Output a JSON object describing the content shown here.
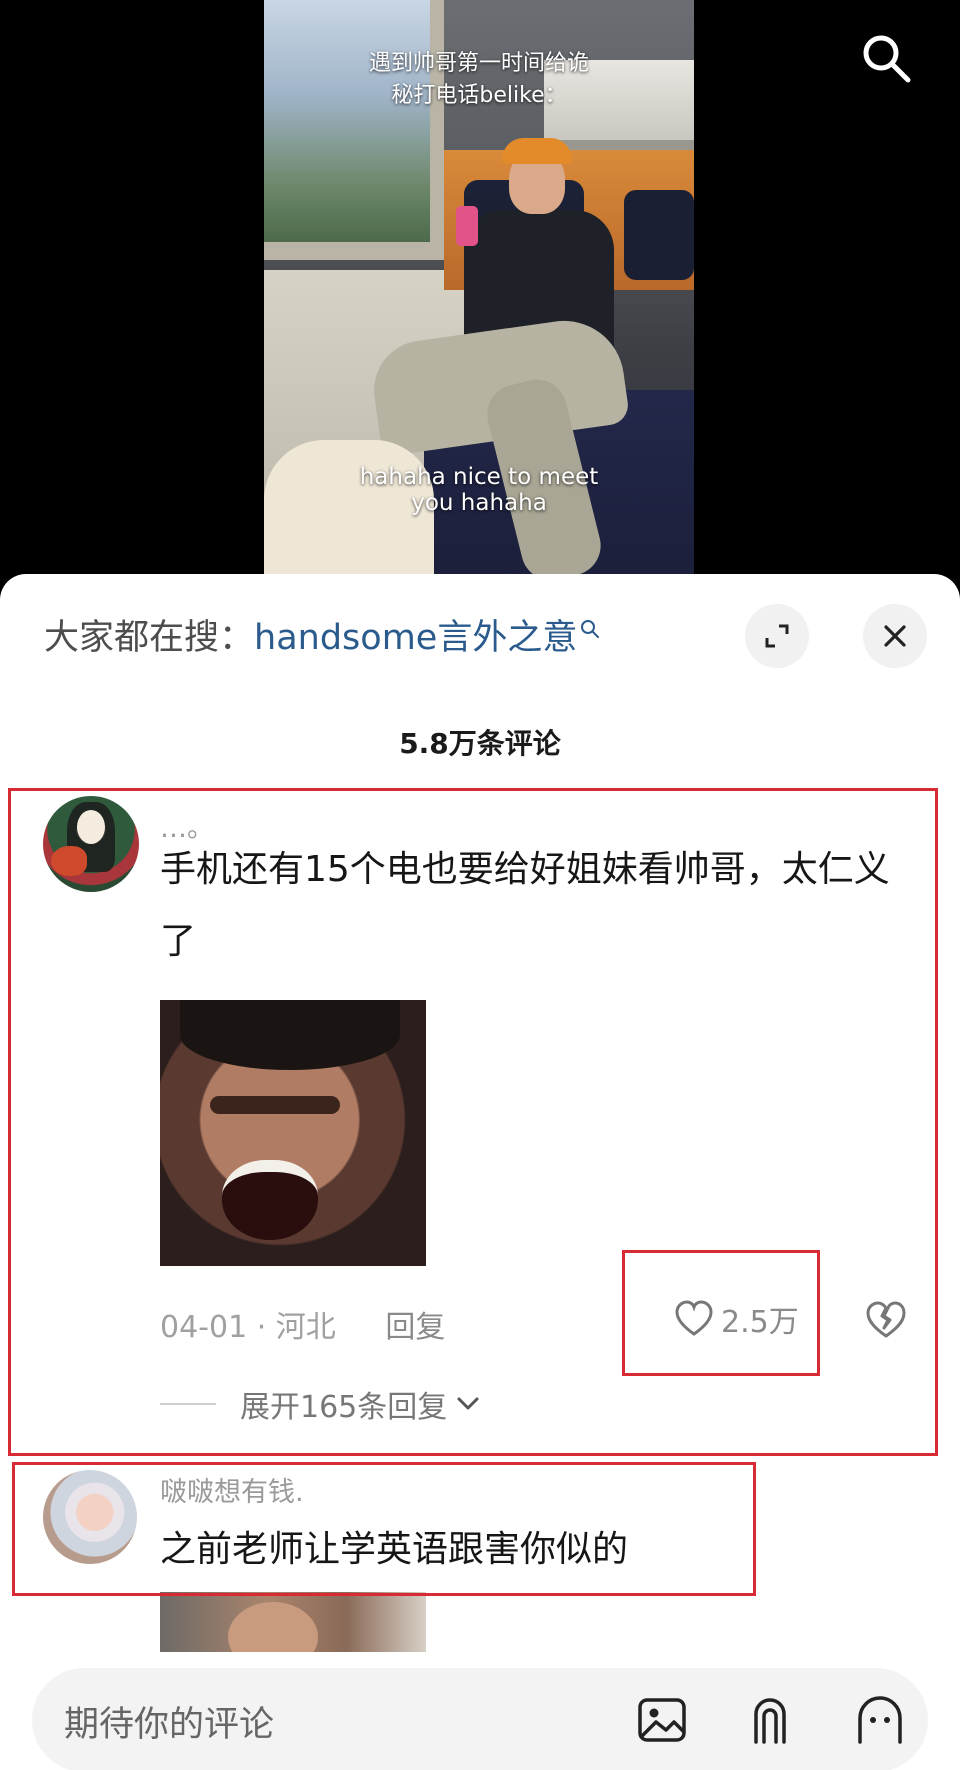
{
  "video": {
    "caption_top_line1": "遇到帅哥第一时间给诡",
    "caption_top_line2": "秘打电话belike：",
    "caption_bottom_line1": "hahaha nice to meet",
    "caption_bottom_line2": "you hahaha"
  },
  "header": {
    "hot_search_label": "大家都在搜：",
    "hot_search_term": "handsome言外之意",
    "comment_count": "5.8万条评论"
  },
  "comments": [
    {
      "username": "…。",
      "text": "手机还有15个电也要给好姐妹看帅哥，太仁义了",
      "meta": "04-01 · 河北",
      "reply_label": "回复",
      "like_count": "2.5万",
      "expand_label": "展开165条回复"
    },
    {
      "username": "啵啵想有钱.",
      "text": "之前老师让学英语跟害你似的"
    }
  ],
  "input": {
    "placeholder": "期待你的评论"
  },
  "icons": {
    "search": "search-icon",
    "expand": "expand-icon",
    "close": "close-icon",
    "heart": "heart-icon",
    "broken_heart": "broken-heart-icon",
    "chevron": "chevron-down-icon",
    "image": "image-icon",
    "at": "at-icon",
    "emoji": "emoji-icon"
  },
  "colors": {
    "highlight": "#d72a35",
    "hot_search_term": "#2b5b8c"
  }
}
